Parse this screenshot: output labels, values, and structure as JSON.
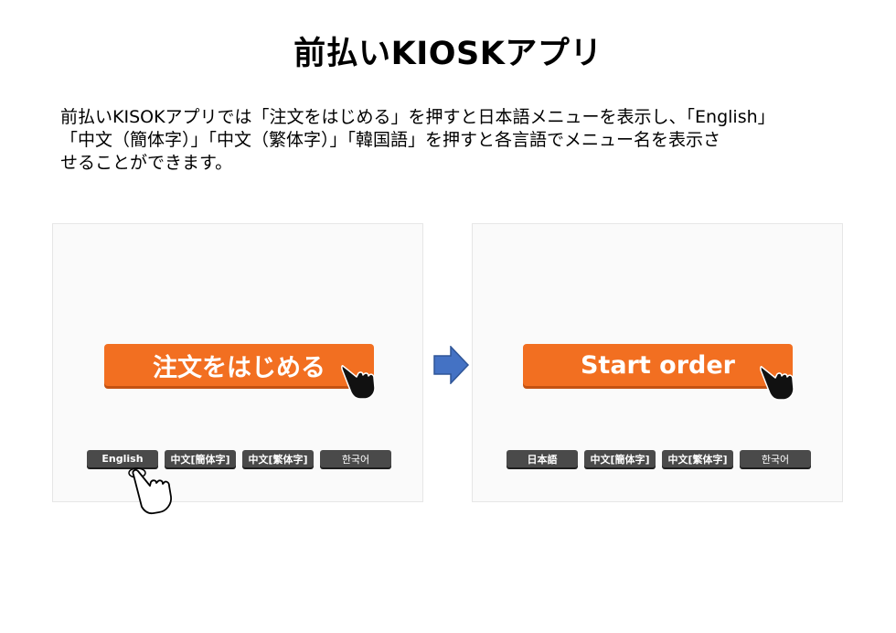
{
  "slide": {
    "title": "前払いKIOSKアプリ",
    "description_lines": [
      "前払いKISOKアプリでは「注文をはじめる」を押すと日本語メニューを表示し、「English」",
      "「中文（簡体字）」「中文（繁体字）」「韓国語」を押すと各言語でメニュー名を表示さ",
      "せることができます。"
    ]
  },
  "left_screen": {
    "start_button": "注文をはじめる",
    "languages": [
      "English",
      "中文[簡体字]",
      "中文[繁体字]",
      "한국어"
    ]
  },
  "right_screen": {
    "start_button": "Start order",
    "languages": [
      "日本語",
      "中文[簡体字]",
      "中文[繁体字]",
      "한국어"
    ]
  },
  "colors": {
    "start_button": "#f26f21",
    "language_button": "#4a4a4a",
    "arrow": "#4472c4"
  },
  "icons": [
    "pointing-hand-icon",
    "tapping-hand-icon",
    "right-arrow-icon"
  ]
}
